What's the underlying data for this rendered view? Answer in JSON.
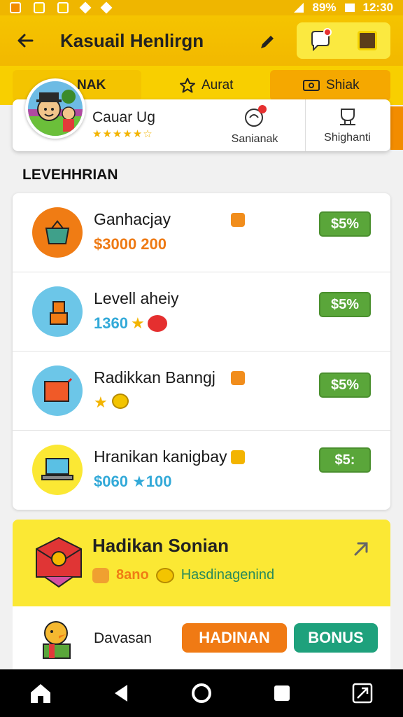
{
  "status_bar": {
    "battery": "89%",
    "time": "12:30"
  },
  "app_bar": {
    "title": "Kasuail Henlirgn"
  },
  "tabs": [
    {
      "label": "NAK"
    },
    {
      "label": "Aurat"
    },
    {
      "label": "Shiak"
    }
  ],
  "profile": {
    "name": "Cauar Ug",
    "stars": "★★★★★☆",
    "action1_label": "Sanianak",
    "action2_label": "Shighanti"
  },
  "section": {
    "title": "LEVEHHRIAN"
  },
  "items": [
    {
      "title": "Ganhacjay",
      "subtitle": "$3000 200",
      "button": "$5%",
      "subtitle_color": "#ee7a14",
      "icon_bg": "#f07c14",
      "icon": "basket-icon"
    },
    {
      "title": "Levell aheiy",
      "subtitle": "1360",
      "button": "$5%",
      "subtitle_color": "#32a9d8",
      "icon_bg": "#6cc6e8",
      "icon": "tower-icon"
    },
    {
      "title": "Radikkan Banngj",
      "subtitle": "",
      "button": "$5%",
      "subtitle_color": "#f3b400",
      "icon_bg": "#6cc6e8",
      "icon": "gift-icon"
    },
    {
      "title": "Hranikan kanigbay",
      "subtitle": "$060 ★100",
      "button": "$5:",
      "subtitle_color": "#32a9d8",
      "icon_bg": "#fbe834",
      "icon": "laptop-icon"
    }
  ],
  "promo": {
    "title": "Hadikan Sonian",
    "sub_small": "8ano",
    "sub_link": "Hasdinagenind"
  },
  "bottom": {
    "label": "Davasan",
    "btn_primary": "HADINAN",
    "btn_secondary": "BONUS"
  }
}
